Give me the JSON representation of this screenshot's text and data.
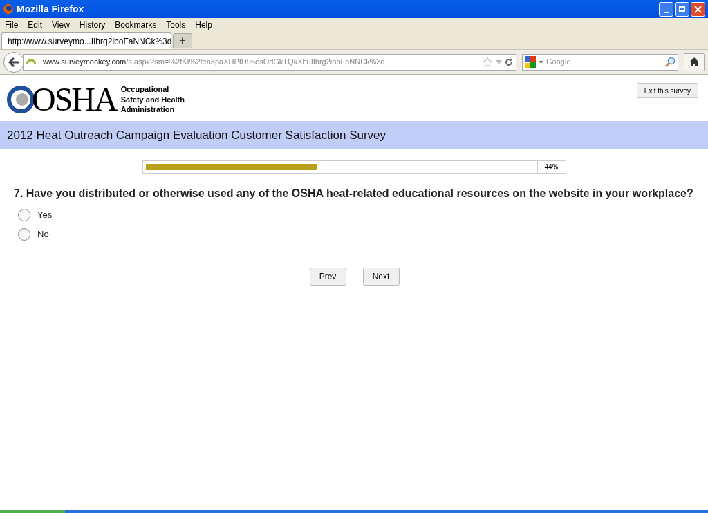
{
  "window": {
    "title": "Mozilla Firefox"
  },
  "menu": [
    "File",
    "Edit",
    "View",
    "History",
    "Bookmarks",
    "Tools",
    "Help"
  ],
  "tabs": [
    {
      "label": "http://www.surveymo...IIhrg2iboFaNNCk%3d",
      "selected": true
    }
  ],
  "new_tab": "+",
  "address_bar": {
    "domain": "www.surveymonkey.com",
    "path": "/s.aspx?sm=%2fKI%2fen3paXHPID96esOdGkTQkXbuIIhrg2iboFaNNCk%3d"
  },
  "search": {
    "placeholder": "Google"
  },
  "header": {
    "logo": "OSHA",
    "agency": [
      "Occupational",
      "Safety and Health",
      "Administration"
    ],
    "exit_button": "Exit this survey"
  },
  "survey_title": "2012 Heat Outreach Campaign Evaluation Customer Satisfaction Survey",
  "progress": {
    "level": 0.44,
    "reading": "44%"
  },
  "question": "7. Have you distributed or otherwise used any of the OSHA heat-related educational resources on the website in your workplace?",
  "options": [
    {
      "label": "Yes",
      "selected": false
    },
    {
      "label": "No",
      "selected": false
    }
  ],
  "buttons": [
    "Prev",
    "Next"
  ]
}
